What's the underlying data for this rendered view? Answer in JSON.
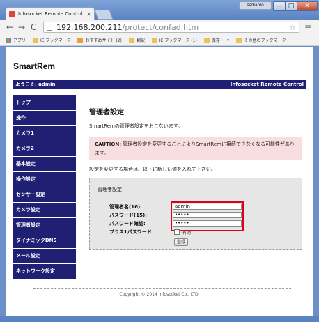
{
  "window": {
    "user_label": "ssdiablo",
    "minimize": "—",
    "maximize": "□",
    "close": "✕"
  },
  "tab": {
    "title": "Infosocket Remote Control",
    "close": "✕"
  },
  "toolbar": {
    "back": "←",
    "forward": "→",
    "reload": "C",
    "url_host": "192.168.200.211",
    "url_path": "/protect/confad.htm",
    "star": "☆",
    "menu": "≡"
  },
  "bookmarks": [
    {
      "label": "アプリ",
      "icon": "apps-icon"
    },
    {
      "label": "IE ブックマーク",
      "icon": "folder-icon"
    },
    {
      "label": "おすすめサイト (2)",
      "icon": "extension-icon"
    },
    {
      "label": "翻訳",
      "icon": "folder-icon"
    },
    {
      "label": "IE ブックマーク (1)",
      "icon": "folder-icon"
    },
    {
      "label": "保存",
      "icon": "folder-icon"
    },
    {
      "label": "»",
      "icon": ""
    },
    {
      "label": "その他のブックマーク",
      "icon": "folder-icon"
    }
  ],
  "site": {
    "logo": "SmartRem",
    "welcome": "ようこそ, admin",
    "product": "Infosocket Remote Control"
  },
  "nav": [
    "トップ",
    "操作",
    "カメラ1",
    "カメラ2",
    "基本設定",
    "操作設定",
    "センサー設定",
    "カメラ設定",
    "管理者設定",
    "ダイナミックDNS",
    "メール設定",
    "ネットワーク設定"
  ],
  "main": {
    "title": "管理者設定",
    "description": "SmartRemの管理者設定をおこないます。",
    "caution_label": "CAUTION:",
    "caution_text": " 管理者設定を変更することによりSmartRemに接続できなくなる可能性があります。",
    "instruction": "設定を変更する場合は、以下に新しい値を入れて下さい。",
    "form": {
      "legend": "管理者設定",
      "username_label": "管理者名(16):",
      "username_value": "admin",
      "password_label": "パスワード(15):",
      "password_value": "•••••",
      "confirm_label": "パスワード確認:",
      "confirm_value": "•••••",
      "plus1_label": "プラス1パスワード",
      "plus1_checkbox_label": "有効",
      "submit": "登録"
    }
  },
  "footer": {
    "copyright": "Copyright © 2014 Infosocket Co., LTD."
  },
  "colors": {
    "nav_bg": "#1f1f74",
    "caution_bg": "#f8dede",
    "highlight": "#e0001b",
    "form_bg": "#e6e6e6"
  }
}
